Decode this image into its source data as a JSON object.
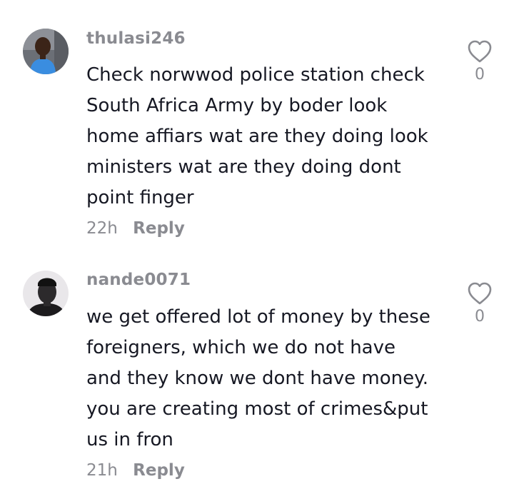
{
  "comments": [
    {
      "username": "thulasi246",
      "text_lines": [
        "Check norwwod police station check",
        "South Africa Army by boder look",
        "home affiars wat are they doing look",
        "ministers wat are they doing dont",
        "point finger"
      ],
      "time": "22h",
      "reply_label": "Reply",
      "like_count": "0",
      "like_icon": "heart-outline-icon"
    },
    {
      "username": "nande0071",
      "text_lines": [
        "we get offered lot of money by these",
        "foreigners, which we do not have",
        "and they know we dont have money.",
        "you are creating most of crimes&put",
        "us in fron"
      ],
      "time": "21h",
      "reply_label": "Reply",
      "like_count": "0",
      "like_icon": "heart-outline-icon"
    }
  ],
  "colors": {
    "primary_text": "#161823",
    "secondary_text": "#8a8b91",
    "background": "#ffffff"
  }
}
